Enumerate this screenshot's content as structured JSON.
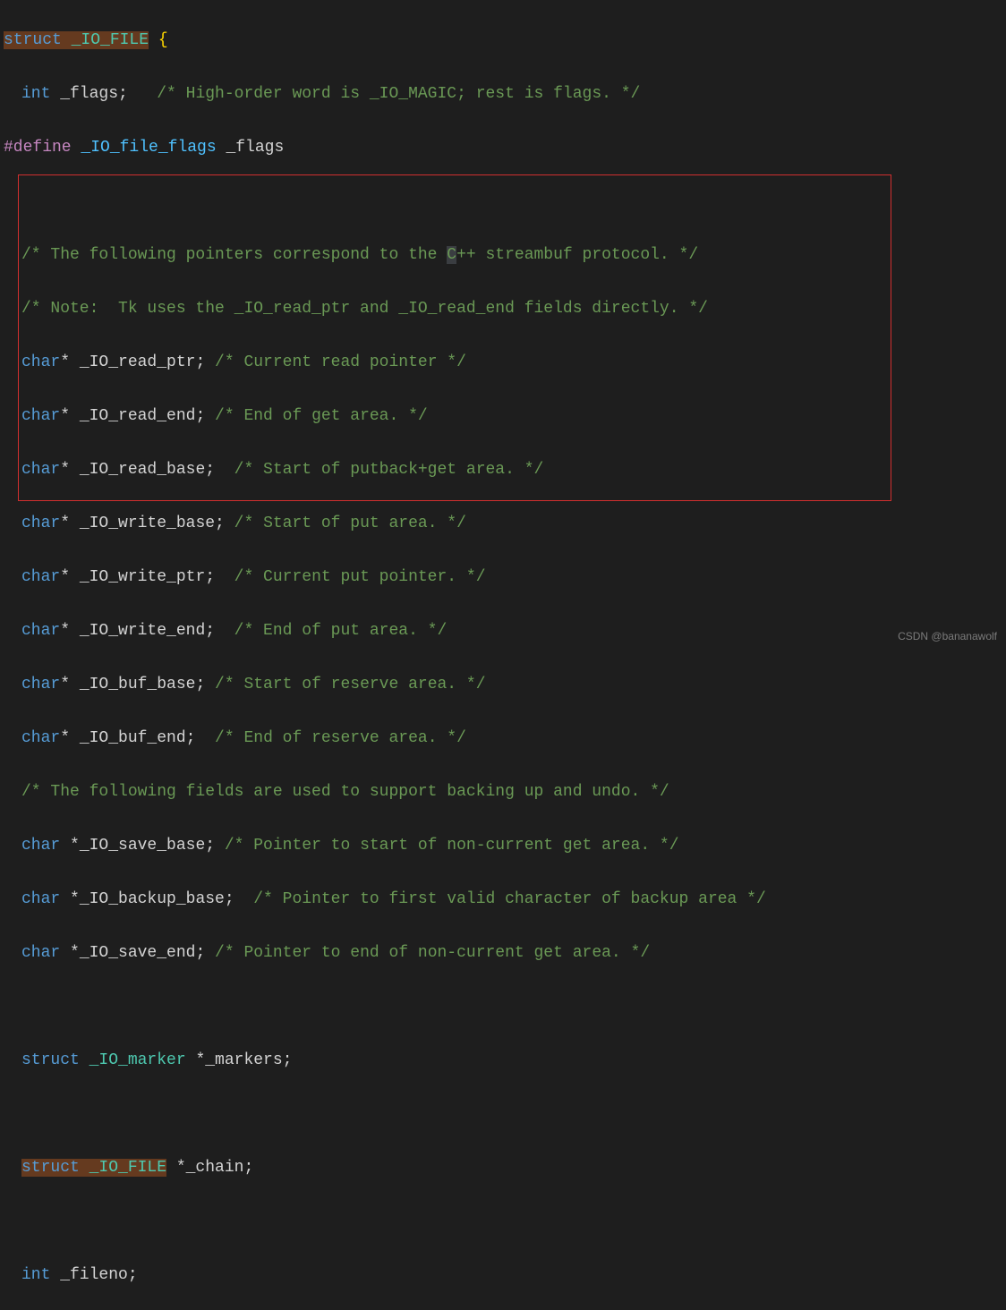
{
  "lines": {
    "l1": {
      "kw": "struct",
      "type": "_IO_FILE",
      "brace": " {"
    },
    "l2": {
      "kw": "int",
      "field": " _flags;",
      "comment": "   /* High-order word is _IO_MAGIC; rest is flags. */"
    },
    "l3": {
      "pp": "#define ",
      "name": "_IO_file_flags",
      "rest": " _flags"
    },
    "l5": {
      "comment": "/* The following pointers correspond to the ",
      "c": "C",
      "comment2": "++ streambuf protocol. */"
    },
    "l6": {
      "comment": "/* Note:  Tk uses the _IO_read_ptr and _IO_read_end fields directly. */"
    },
    "l7": {
      "kw": "char",
      "field": "* _IO_read_ptr;",
      "comment": " /* Current read pointer */"
    },
    "l8": {
      "kw": "char",
      "field": "* _IO_read_end;",
      "comment": " /* End of get area. */"
    },
    "l9": {
      "kw": "char",
      "field": "* _IO_read_base;",
      "comment": "  /* Start of putback+get area. */"
    },
    "l10": {
      "kw": "char",
      "field": "* _IO_write_base;",
      "comment": " /* Start of put area. */"
    },
    "l11": {
      "kw": "char",
      "field": "* _IO_write_ptr;",
      "comment": "  /* Current put pointer. */"
    },
    "l12": {
      "kw": "char",
      "field": "* _IO_write_end;",
      "comment": "  /* End of put area. */"
    },
    "l13": {
      "kw": "char",
      "field": "* _IO_buf_base;",
      "comment": " /* Start of reserve area. */"
    },
    "l14": {
      "kw": "char",
      "field": "* _IO_buf_end;",
      "comment": "  /* End of reserve area. */"
    },
    "l15": {
      "comment": "/* The following fields are used to support backing up and undo. */"
    },
    "l16": {
      "kw": "char",
      "field": " *_IO_save_base;",
      "comment": " /* Pointer to start of non-current get area. */"
    },
    "l17": {
      "kw": "char",
      "field": " *_IO_backup_base;",
      "comment": "  /* Pointer to first valid character of backup area */"
    },
    "l18": {
      "kw": "char",
      "field": " *_IO_save_end;",
      "comment": " /* Pointer to end of non-current get area. */"
    },
    "l20": {
      "kw": "struct",
      "type": " _IO_marker",
      "field": " *_markers;"
    },
    "l22": {
      "kw": "struct",
      "type": " _IO_FILE",
      "field": " *_chain;"
    },
    "l24": {
      "kw": "int",
      "field": " _fileno;"
    }
  },
  "watermark": "CSDN @bananawolf"
}
